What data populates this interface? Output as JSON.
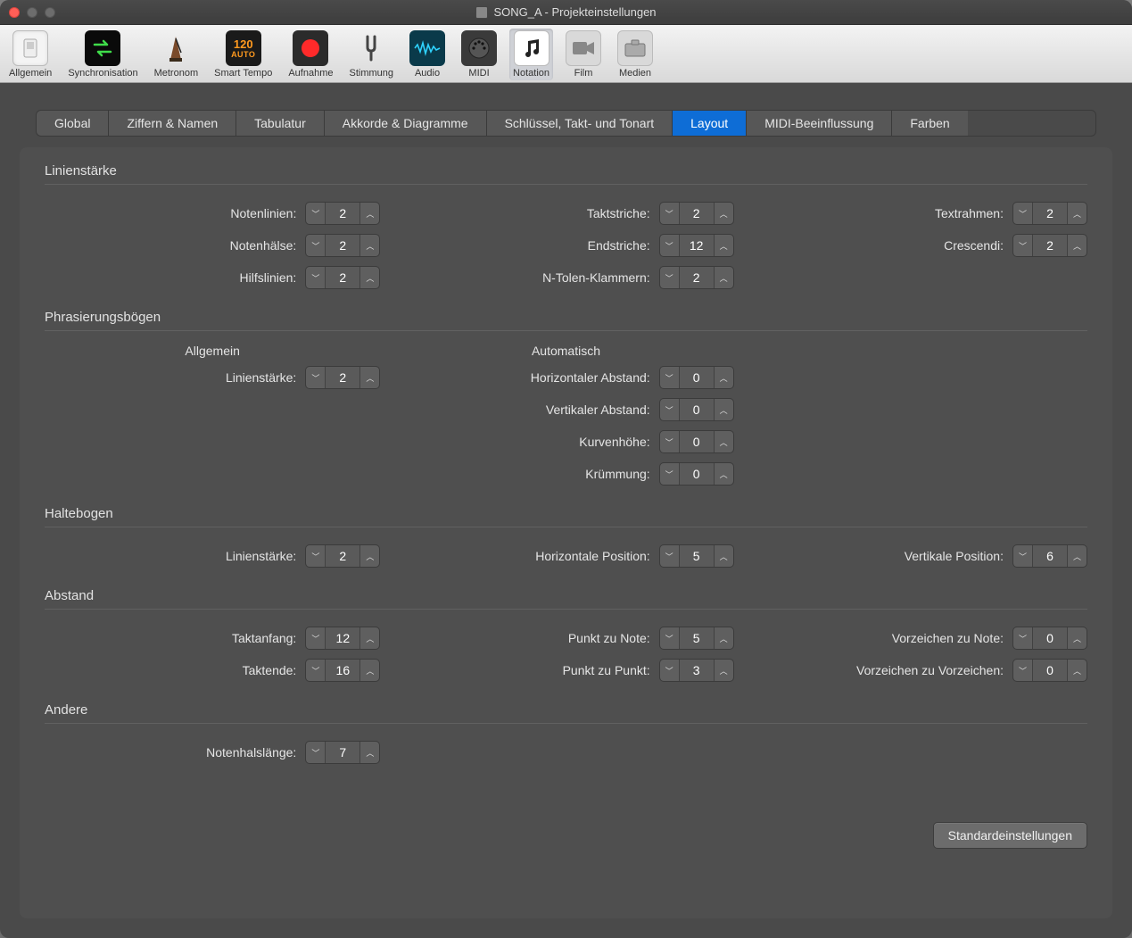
{
  "window": {
    "title": "SONG_A - Projekteinstellungen"
  },
  "toolbar": [
    {
      "id": "allgemein",
      "label": "Allgemein"
    },
    {
      "id": "synchronisation",
      "label": "Synchronisation"
    },
    {
      "id": "metronom",
      "label": "Metronom"
    },
    {
      "id": "smart-tempo",
      "label": "Smart Tempo"
    },
    {
      "id": "aufnahme",
      "label": "Aufnahme"
    },
    {
      "id": "stimmung",
      "label": "Stimmung"
    },
    {
      "id": "audio",
      "label": "Audio"
    },
    {
      "id": "midi",
      "label": "MIDI"
    },
    {
      "id": "notation",
      "label": "Notation"
    },
    {
      "id": "film",
      "label": "Film"
    },
    {
      "id": "medien",
      "label": "Medien"
    }
  ],
  "tabs": [
    {
      "label": "Global"
    },
    {
      "label": "Ziffern & Namen"
    },
    {
      "label": "Tabulatur"
    },
    {
      "label": "Akkorde & Diagramme"
    },
    {
      "label": "Schlüssel, Takt- und Tonart"
    },
    {
      "label": "Layout",
      "active": true
    },
    {
      "label": "MIDI-Beeinflussung"
    },
    {
      "label": "Farben"
    }
  ],
  "sections": {
    "linienstaerke": {
      "title": "Linienstärke",
      "fields": {
        "notenlinien": {
          "label": "Notenlinien:",
          "value": "2"
        },
        "taktstriche": {
          "label": "Taktstriche:",
          "value": "2"
        },
        "textrahmen": {
          "label": "Textrahmen:",
          "value": "2"
        },
        "notenhaelse": {
          "label": "Notenhälse:",
          "value": "2"
        },
        "endstriche": {
          "label": "Endstriche:",
          "value": "12"
        },
        "crescendi": {
          "label": "Crescendi:",
          "value": "2"
        },
        "hilfslinien": {
          "label": "Hilfslinien:",
          "value": "2"
        },
        "ntolen": {
          "label": "N-Tolen-Klammern:",
          "value": "2"
        }
      }
    },
    "phrasierung": {
      "title": "Phrasierungsbögen",
      "colheads": {
        "allgemein": "Allgemein",
        "automatisch": "Automatisch"
      },
      "fields": {
        "linienstaerke": {
          "label": "Linienstärke:",
          "value": "2"
        },
        "hAbstand": {
          "label": "Horizontaler Abstand:",
          "value": "0"
        },
        "vAbstand": {
          "label": "Vertikaler Abstand:",
          "value": "0"
        },
        "kurvenhoehe": {
          "label": "Kurvenhöhe:",
          "value": "0"
        },
        "kruemmung": {
          "label": "Krümmung:",
          "value": "0"
        }
      }
    },
    "haltebogen": {
      "title": "Haltebogen",
      "fields": {
        "linienstaerke": {
          "label": "Linienstärke:",
          "value": "2"
        },
        "hPos": {
          "label": "Horizontale Position:",
          "value": "5"
        },
        "vPos": {
          "label": "Vertikale Position:",
          "value": "6"
        }
      }
    },
    "abstand": {
      "title": "Abstand",
      "fields": {
        "taktanfang": {
          "label": "Taktanfang:",
          "value": "12"
        },
        "punktNote": {
          "label": "Punkt zu Note:",
          "value": "5"
        },
        "vorzNote": {
          "label": "Vorzeichen zu Note:",
          "value": "0"
        },
        "taktende": {
          "label": "Taktende:",
          "value": "16"
        },
        "punktPunkt": {
          "label": "Punkt zu Punkt:",
          "value": "3"
        },
        "vorzVorz": {
          "label": "Vorzeichen zu Vorzeichen:",
          "value": "0"
        }
      }
    },
    "andere": {
      "title": "Andere",
      "fields": {
        "notenhalslaenge": {
          "label": "Notenhalslänge:",
          "value": "7"
        }
      }
    }
  },
  "footer": {
    "defaults_label": "Standardeinstellungen"
  },
  "tempo_badge": "120"
}
